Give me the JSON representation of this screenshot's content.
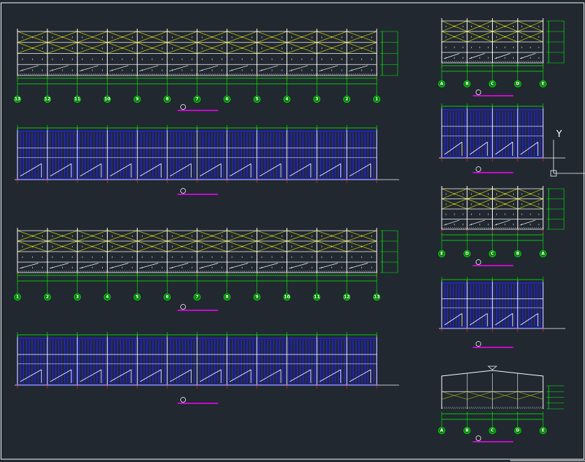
{
  "canvas": {
    "background": "#212830",
    "border_color": "#ffffff"
  },
  "palette": {
    "frame": "#ffffff",
    "dimension": "#00ff00",
    "panel": "#2222ff",
    "bracing": "#c8c800",
    "grid_line": "#ff2222",
    "title_underline": "#ff00ff"
  },
  "ucs_icon": {
    "axis_label": "Y"
  },
  "drawings": [
    {
      "id": "elevation-13-1",
      "kind": "bracing",
      "gridlines": [
        "13",
        "12",
        "11",
        "10",
        "9",
        "8",
        "7",
        "6",
        "5",
        "4",
        "3",
        "2",
        "1"
      ]
    },
    {
      "id": "elevation-front-cladding",
      "kind": "cladding",
      "gridlines": []
    },
    {
      "id": "elevation-1-13",
      "kind": "bracing",
      "gridlines": [
        "1",
        "2",
        "3",
        "4",
        "5",
        "6",
        "7",
        "8",
        "9",
        "10",
        "11",
        "12",
        "13"
      ]
    },
    {
      "id": "elevation-back-cladding",
      "kind": "cladding",
      "gridlines": []
    },
    {
      "id": "elevation-A-E",
      "kind": "bracing",
      "gridlines": [
        "A",
        "B",
        "C",
        "D",
        "E"
      ]
    },
    {
      "id": "elevation-end-cladding-1",
      "kind": "cladding",
      "gridlines": []
    },
    {
      "id": "elevation-E-A",
      "kind": "bracing",
      "gridlines": [
        "E",
        "D",
        "C",
        "B",
        "A"
      ]
    },
    {
      "id": "elevation-end-cladding-2",
      "kind": "cladding",
      "gridlines": []
    },
    {
      "id": "section-A-E",
      "kind": "section",
      "gridlines": [
        "A",
        "B",
        "C",
        "D",
        "E"
      ]
    }
  ]
}
